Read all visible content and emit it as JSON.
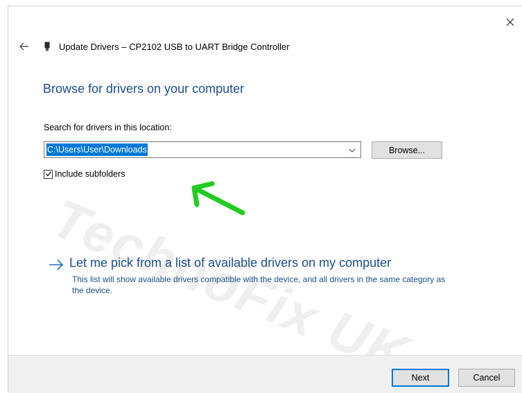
{
  "dialog": {
    "title": "Update Drivers – CP2102 USB to UART Bridge Controller",
    "heading": "Browse for drivers on your computer"
  },
  "search": {
    "label": "Search for drivers in this location:",
    "path_value": "C:\\Users\\User\\Downloads",
    "browse_label": "Browse..."
  },
  "options": {
    "include_subfolders_label": "Include subfolders",
    "include_subfolders_checked": true
  },
  "pick_option": {
    "title": "Let me pick from a list of available drivers on my computer",
    "description": "This list will show available drivers compatible with the device, and all drivers in the same category as the device."
  },
  "footer": {
    "next_label": "Next",
    "cancel_label": "Cancel"
  },
  "watermark": "TechnoFix UK",
  "icons": {
    "close": "close-icon",
    "back": "back-arrow-icon",
    "device": "usb-device-icon",
    "dropdown": "chevron-down-icon",
    "checkbox": "checkmark-icon",
    "pick": "right-arrow-icon",
    "annotation": "green-arrow-icon"
  },
  "colors": {
    "accent": "#0078d7",
    "heading_blue": "#1c4e8c",
    "annotation_green": "#22cc22",
    "footer_bg": "#f0f0f0"
  }
}
